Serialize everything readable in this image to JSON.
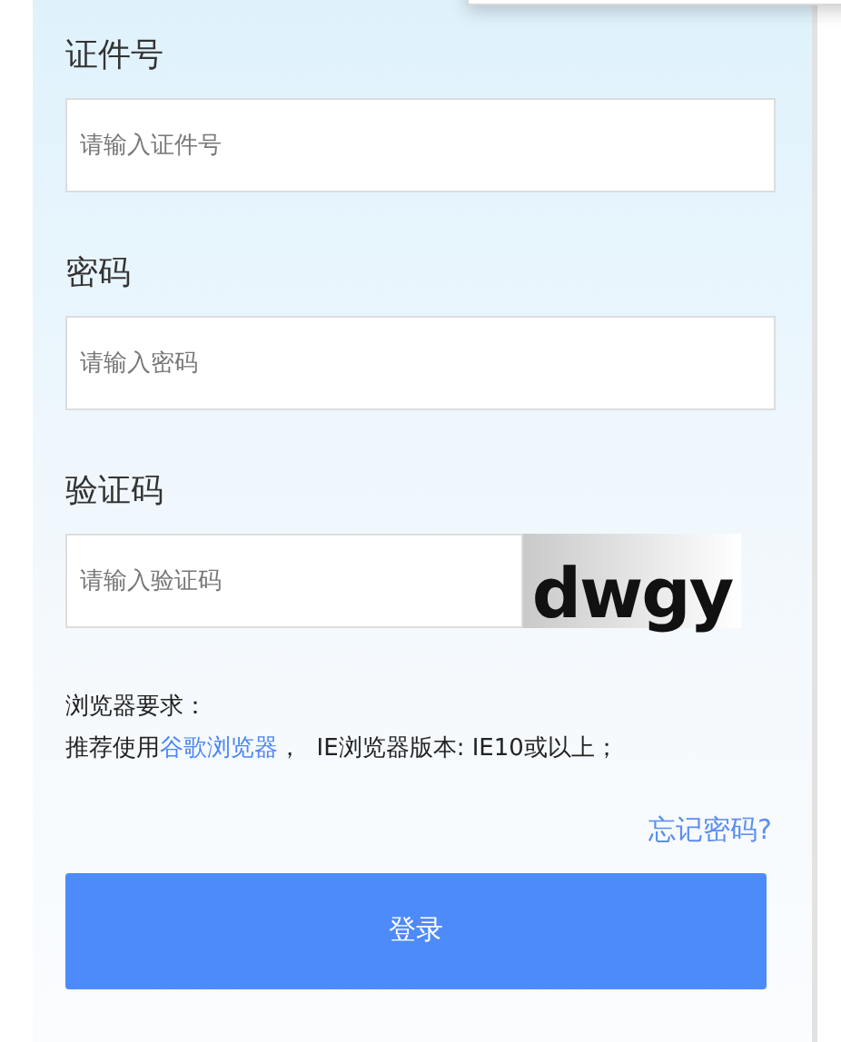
{
  "fields": [
    {
      "kind": "text",
      "label": "证件号",
      "placeholder": "请输入证件号"
    },
    {
      "kind": "password",
      "label": "密码",
      "placeholder": "请输入密码"
    },
    {
      "kind": "captcha",
      "label": "验证码",
      "placeholder": "请输入验证码",
      "captcha": "dwgy"
    }
  ],
  "browser_note": {
    "title": "浏览器要求：",
    "prefix": "推荐使用",
    "link": "谷歌浏览器",
    "suffix": "，  IE浏览器版本: IE10或以上；"
  },
  "forgot_link": "忘记密码?",
  "login_button": "登录"
}
